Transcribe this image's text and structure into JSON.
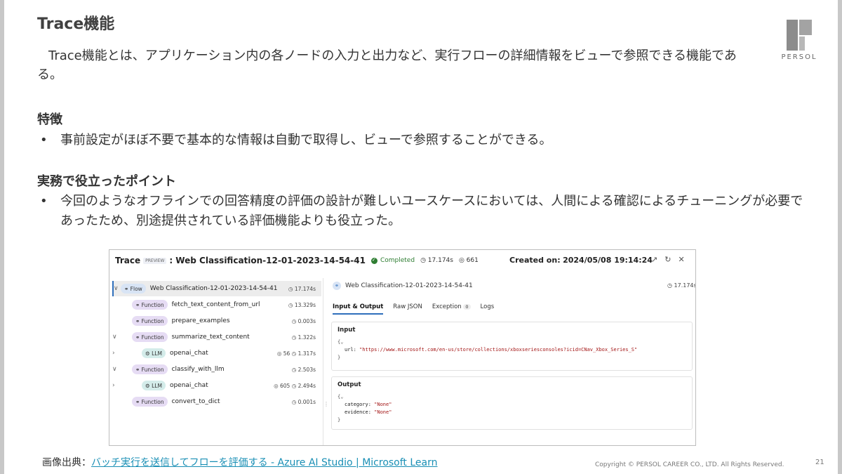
{
  "slide": {
    "title": "Trace機能",
    "intro": "Trace機能とは、アプリケーション内の各ノードの入力と出力など、実行フローの詳細情報をビューで参照できる機能である。",
    "feature_heading": "特徴",
    "feature_bullet": "事前設定がほぼ不要で基本的な情報は自動で取得し、ビューで参照することができる。",
    "points_heading": "実務で役立ったポイント",
    "points_bullet": "今回のようなオフラインでの回答精度の評価の設計が難しいユースケースにおいては、人間による確認によるチューニングが必要であったため、別途提供されている評価機能よりも役立った。",
    "bullet_symbol": "•",
    "logo_text": "PERSOL",
    "source_prefix": "画像出典：",
    "source_link": "バッチ実行を送信してフローを評価する - Azure AI Studio | Microsoft Learn",
    "copyright": "Copyright © PERSOL CAREER CO., LTD. All Rights Reserved.",
    "page_number": "21"
  },
  "trace": {
    "title": "Trace",
    "preview": "PREVIEW",
    "name": ": Web Classification-12-01-2023-14-54-41",
    "status": "Completed",
    "duration": "◷ 17.174s",
    "tokens": "◎ 661",
    "created_label": "Created on:",
    "created_value": "2024/05/08 19:14:24",
    "icons": [
      "↗",
      "↻",
      "✕"
    ],
    "nodes": [
      {
        "chev": "∨",
        "badge": "⚭ Flow",
        "name": "Web Classification-12-01-2023-14-54-41",
        "dur": "◷ 17.174s"
      },
      {
        "chev": "",
        "badge": "⚭ Function",
        "name": "fetch_text_content_from_url",
        "dur": "◷ 13.329s"
      },
      {
        "chev": "",
        "badge": "⚭ Function",
        "name": "prepare_examples",
        "dur": "◷ 0.003s"
      },
      {
        "chev": "∨",
        "badge": "⚭ Function",
        "name": "summarize_text_content",
        "dur": "◷ 1.322s"
      },
      {
        "chev": "›",
        "badge": "⚙ LLM",
        "name": "openai_chat",
        "dur": "◎ 56 ◷ 1.317s"
      },
      {
        "chev": "∨",
        "badge": "⚭ Function",
        "name": "classify_with_llm",
        "dur": "◷ 2.503s"
      },
      {
        "chev": "›",
        "badge": "⚙ LLM",
        "name": "openai_chat",
        "dur": "◎ 605 ◷ 2.494s"
      },
      {
        "chev": "",
        "badge": "⚭ Function",
        "name": "convert_to_dict",
        "dur": "◷ 0.001s"
      }
    ],
    "detail": {
      "name": "Web Classification-12-01-2023-14-54-41",
      "dur": "◷ 17.174s",
      "tabs": [
        "Input & Output",
        "Raw JSON",
        "Exception",
        "Logs"
      ],
      "exception_count": "0",
      "input_title": "Input",
      "input_open": "{⌄",
      "input_key": "url:",
      "input_value": "\"https://www.microsoft.com/en-us/store/collections/xboxseriesconsoles?icid=CNav_Xbox_Series_S\"",
      "input_close": "}",
      "output_title": "Output",
      "output_open": "{⌄",
      "output_key1": "category:",
      "output_val1": "\"None\"",
      "output_key2": "evidence:",
      "output_val2": "\"None\"",
      "output_close": "}"
    },
    "splitter": "⋮"
  }
}
